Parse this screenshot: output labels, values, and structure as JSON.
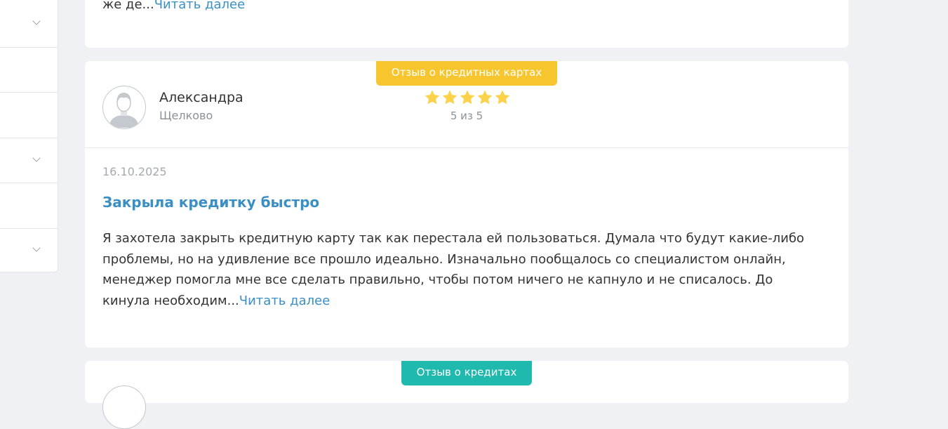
{
  "top_review": {
    "excerpt": "же де...",
    "read_more": "Читать далее"
  },
  "main_review": {
    "tag": "Отзыв о кредитных картах",
    "tag_color": "#f7c62f",
    "author": {
      "name": "Александра",
      "city": "Щелково",
      "avatar_icon": "user-avatar-icon"
    },
    "rating": {
      "value": 5,
      "max": 5,
      "text": "5 из 5",
      "star_color": "#fbd24a"
    },
    "date": "16.10.2025",
    "title": "Закрыла кредитку быстро",
    "body": "Я захотела закрыть кредитную карту так как перестала ей пользоваться. Думала что будут какие-либо проблемы, но на удивление все прошло идеально. Изначально пообщалось со специалистом онлайн, менеджер помогла мне все сделать правильно, чтобы потом ничего не капнуло и не списалось. До кинула необходим...",
    "read_more": "Читать далее",
    "link_color": "#3a8fc4"
  },
  "next_review": {
    "tag": "Отзыв о кредитах",
    "tag_color": "#1fb9ae"
  },
  "sidebar": {
    "icon": "chevron-down-icon",
    "rows": [
      {
        "has_chevron": true
      },
      {
        "has_chevron": false
      },
      {
        "has_chevron": false
      },
      {
        "has_chevron": true
      },
      {
        "has_chevron": false
      },
      {
        "has_chevron": true
      }
    ]
  }
}
